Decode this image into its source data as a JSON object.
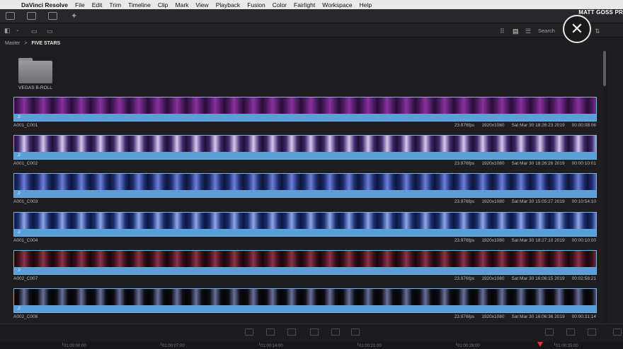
{
  "menubar": {
    "apple": "",
    "app": "DaVinci Resolve",
    "items": [
      "File",
      "Edit",
      "Trim",
      "Timeline",
      "Clip",
      "Mark",
      "View",
      "Playback",
      "Fusion",
      "Color",
      "Fairlight",
      "Workspace",
      "Help"
    ]
  },
  "header": {
    "right_text": "MATT GOSS PR"
  },
  "search": {
    "label": "Search"
  },
  "close_glyph": "✕",
  "breadcrumb": {
    "root": "Master",
    "separator": ">",
    "current": "FIVE STARS"
  },
  "folder": {
    "label": "VEGAS B-ROLL"
  },
  "clips": [
    {
      "name": "A001_C001",
      "fps": "23.976fps",
      "res": "1920x1080",
      "date": "Sat Mar 30 18:26:23 2019",
      "dur": "00:00:08:06",
      "note": "♫",
      "tone": [
        "#4a1a5e",
        "#8a2f9e",
        "#2a0d38"
      ]
    },
    {
      "name": "A001_C002",
      "fps": "23.976fps",
      "res": "1920x1080",
      "date": "Sat Mar 30 18:26:26 2019",
      "dur": "00:00:10:01",
      "note": "♫",
      "tone": [
        "#3b2a6a",
        "#d8c6ef",
        "#1d1236"
      ]
    },
    {
      "name": "A001_C003",
      "fps": "23.976fps",
      "res": "1920x1080",
      "date": "Sat Mar 30 15:05:27 2019",
      "dur": "00:10:54:10",
      "note": "♫",
      "tone": [
        "#1d2a6e",
        "#6b7fd6",
        "#0f1538"
      ]
    },
    {
      "name": "A001_C004",
      "fps": "23.976fps",
      "res": "1920x1080",
      "date": "Sat Mar 30 18:27:10 2019",
      "dur": "00:00:10:00",
      "note": "♫",
      "tone": [
        "#1a2e70",
        "#8fa6e8",
        "#0d1640"
      ]
    },
    {
      "name": "A002_C007",
      "fps": "23.976fps",
      "res": "1920x1080",
      "date": "Sat Mar 30 16:06:15 2019",
      "dur": "00:02:58:21",
      "note": "♫",
      "tone": [
        "#3a0e1e",
        "#8a3348",
        "#1a060d"
      ]
    },
    {
      "name": "A002_C008",
      "fps": "23.976fps",
      "res": "1920x1080",
      "date": "Sat Mar 30 16:06:36 2019",
      "dur": "00:00:31:14",
      "note": "♫",
      "tone": [
        "#0c0c12",
        "#6a6f9a",
        "#050507"
      ]
    }
  ],
  "timecodes": [
    "01:00:00:00",
    "01:00:07:00",
    "01:00:14:00",
    "01:00:21:00",
    "01:00:28:00",
    "01:00:35:00"
  ],
  "colors": {
    "accent_blue": "#5a9fd8",
    "playhead": "#e03131"
  }
}
